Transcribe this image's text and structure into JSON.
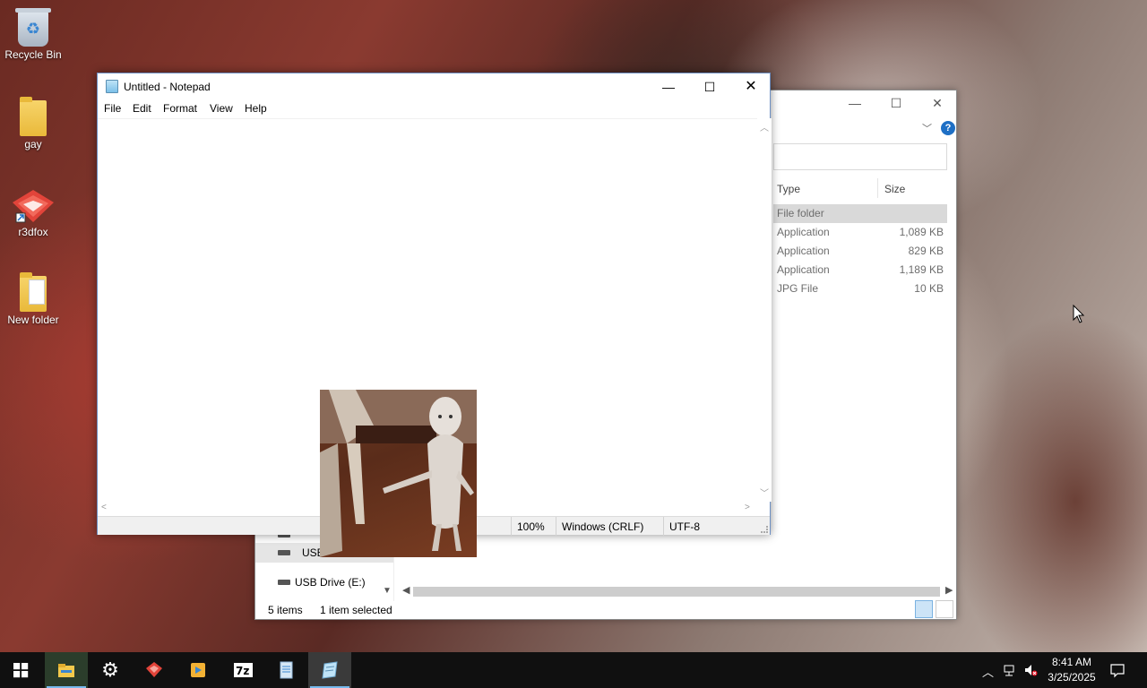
{
  "desktop": {
    "icons": [
      {
        "label": "Recycle Bin",
        "icon": "recycle-bin-icon"
      },
      {
        "label": "gay",
        "icon": "folder-icon"
      },
      {
        "label": "r3dfox",
        "icon": "r3dfox-icon"
      },
      {
        "label": "New folder",
        "icon": "folder-icon"
      }
    ]
  },
  "notepad": {
    "title": "Untitled - Notepad",
    "menu": [
      "File",
      "Edit",
      "Format",
      "View",
      "Help"
    ],
    "content": "",
    "status": {
      "zoom": "100%",
      "line_ending": "Windows (CRLF)",
      "encoding": "UTF-8"
    }
  },
  "explorer": {
    "columns": {
      "type": "Type",
      "size": "Size"
    },
    "rows": [
      {
        "type": "File folder",
        "size": "",
        "selected": true
      },
      {
        "type": "Application",
        "size": "1,089 KB"
      },
      {
        "type": "Application",
        "size": "829 KB"
      },
      {
        "type": "Application",
        "size": "1,189 KB"
      },
      {
        "type": "JPG File",
        "size": "10 KB"
      }
    ],
    "nav": {
      "partial_item": "USB",
      "drive_item": "USB Drive (E:)"
    },
    "status": {
      "items": "5 items",
      "selection": "1 item selected"
    }
  },
  "taskbar": {
    "apps": [
      "start",
      "file-explorer",
      "settings",
      "r3dfox",
      "media-player",
      "7zip",
      "notepad-doc",
      "notepad"
    ],
    "clock": {
      "time": "8:41 AM",
      "date": "3/25/2025"
    }
  },
  "colors": {
    "accent": "#76b9ed",
    "taskbar": "#101010",
    "help_blue": "#1e6fc5"
  }
}
